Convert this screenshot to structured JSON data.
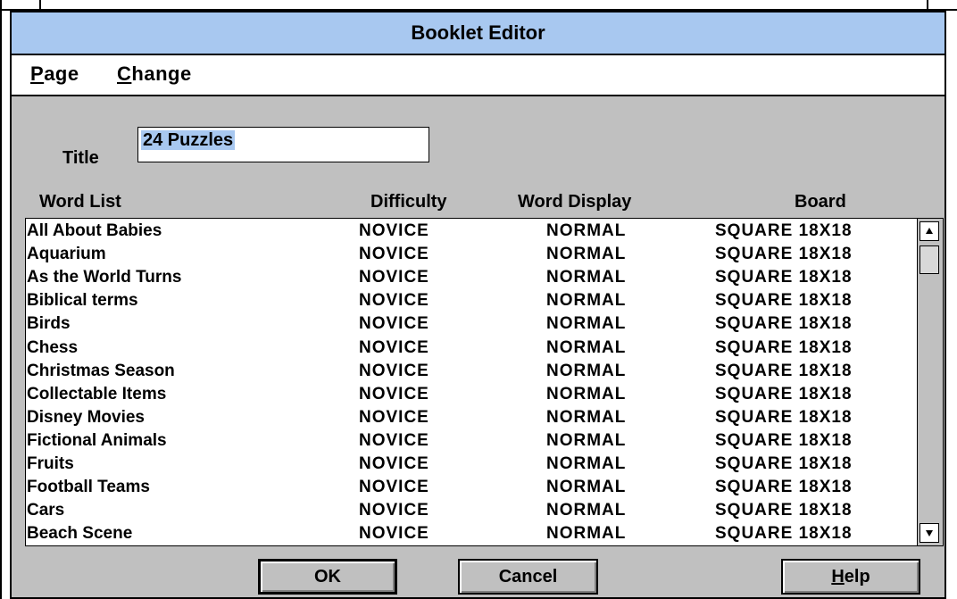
{
  "window": {
    "title": "Booklet Editor"
  },
  "menu": [
    {
      "accel": "P",
      "rest": "age"
    },
    {
      "accel": "C",
      "rest": "hange"
    }
  ],
  "form": {
    "title_label": "Title",
    "title_value": "24 Puzzles"
  },
  "columns": {
    "word_list": "Word List",
    "difficulty": "Difficulty",
    "word_display": "Word Display",
    "board": "Board"
  },
  "rows": [
    {
      "name": "All About Babies",
      "difficulty": "NOVICE",
      "display": "NORMAL",
      "board": "SQUARE 18X18"
    },
    {
      "name": "Aquarium",
      "difficulty": "NOVICE",
      "display": "NORMAL",
      "board": "SQUARE 18X18"
    },
    {
      "name": "As the World Turns",
      "difficulty": "NOVICE",
      "display": "NORMAL",
      "board": "SQUARE 18X18"
    },
    {
      "name": "Biblical terms",
      "difficulty": "NOVICE",
      "display": "NORMAL",
      "board": "SQUARE 18X18"
    },
    {
      "name": "Birds",
      "difficulty": "NOVICE",
      "display": "NORMAL",
      "board": "SQUARE 18X18"
    },
    {
      "name": "Chess",
      "difficulty": "NOVICE",
      "display": "NORMAL",
      "board": "SQUARE 18X18"
    },
    {
      "name": "Christmas Season",
      "difficulty": "NOVICE",
      "display": "NORMAL",
      "board": "SQUARE 18X18"
    },
    {
      "name": "Collectable Items",
      "difficulty": "NOVICE",
      "display": "NORMAL",
      "board": "SQUARE 18X18"
    },
    {
      "name": "Disney Movies",
      "difficulty": "NOVICE",
      "display": "NORMAL",
      "board": "SQUARE 18X18"
    },
    {
      "name": "Fictional Animals",
      "difficulty": "NOVICE",
      "display": "NORMAL",
      "board": "SQUARE 18X18"
    },
    {
      "name": "Fruits",
      "difficulty": "NOVICE",
      "display": "NORMAL",
      "board": "SQUARE 18X18"
    },
    {
      "name": "Football Teams",
      "difficulty": "NOVICE",
      "display": "NORMAL",
      "board": "SQUARE 18X18"
    },
    {
      "name": "Cars",
      "difficulty": "NOVICE",
      "display": "NORMAL",
      "board": "SQUARE 18X18"
    },
    {
      "name": "Beach Scene",
      "difficulty": "NOVICE",
      "display": "NORMAL",
      "board": "SQUARE 18X18"
    }
  ],
  "scrollbar": {
    "up_icon": "arrow-up-icon",
    "down_icon": "arrow-down-icon"
  },
  "buttons": {
    "ok": "OK",
    "cancel": "Cancel",
    "help_accel": "H",
    "help_rest": "elp"
  },
  "colors": {
    "titlebar": "#a8c8f0",
    "face": "#c0c0c0",
    "selection": "#a8c8f0"
  }
}
